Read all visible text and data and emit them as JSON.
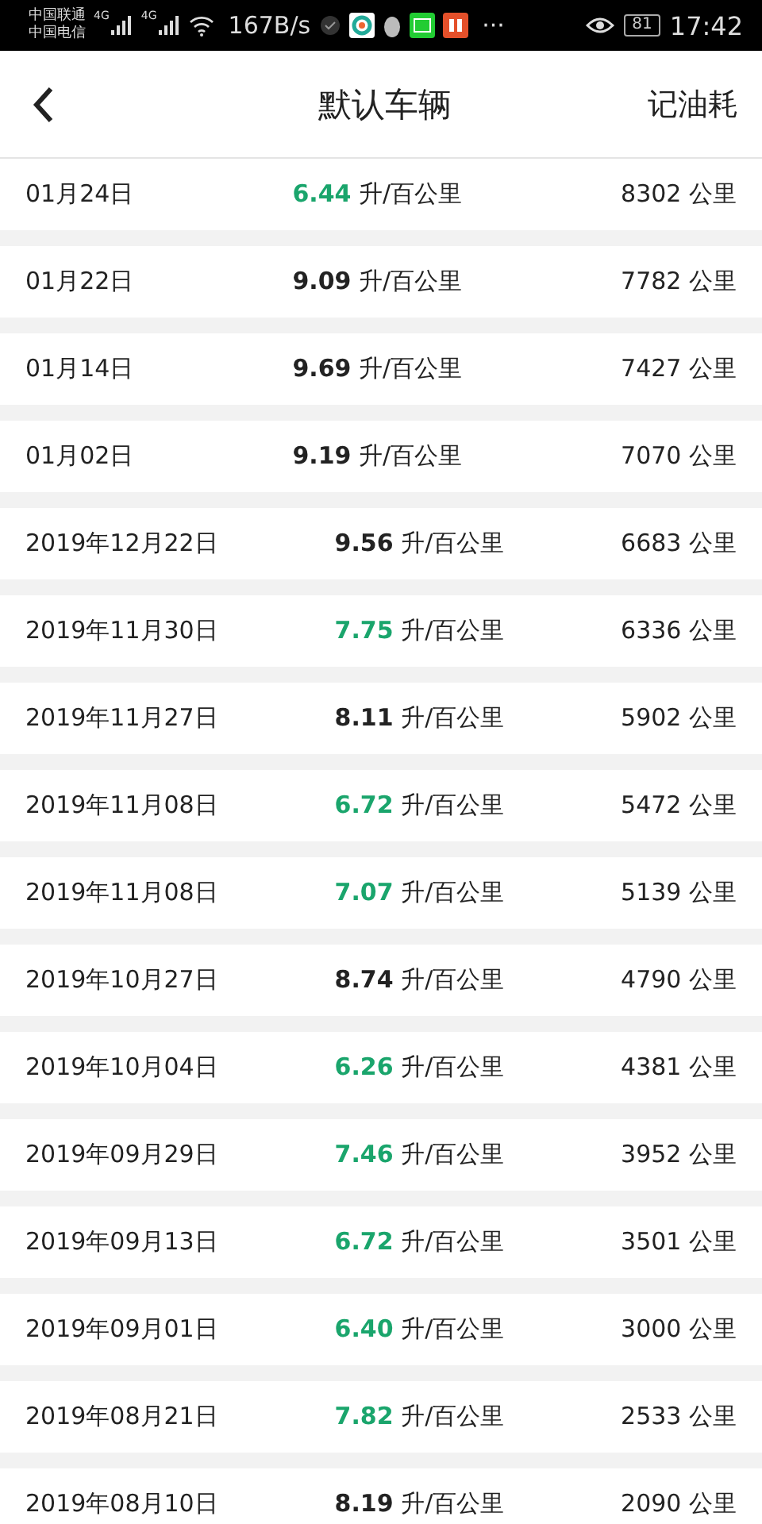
{
  "status_bar": {
    "carriers": [
      "中国联通",
      "中国电信"
    ],
    "network_labels": [
      "4G",
      "4G"
    ],
    "speed": "167B/s",
    "more": "···",
    "battery": "81",
    "time": "17:42"
  },
  "header": {
    "title": "默认车辆",
    "action": "记油耗"
  },
  "records": [
    {
      "date": "01月24日",
      "consumption": "6.44",
      "unit": "升/百公里",
      "odometer": "8302 公里",
      "highlight": true
    },
    {
      "date": "01月22日",
      "consumption": "9.09",
      "unit": "升/百公里",
      "odometer": "7782 公里",
      "highlight": false
    },
    {
      "date": "01月14日",
      "consumption": "9.69",
      "unit": "升/百公里",
      "odometer": "7427 公里",
      "highlight": false
    },
    {
      "date": "01月02日",
      "consumption": "9.19",
      "unit": "升/百公里",
      "odometer": "7070 公里",
      "highlight": false
    },
    {
      "date": "2019年12月22日",
      "consumption": "9.56",
      "unit": "升/百公里",
      "odometer": "6683 公里",
      "highlight": false
    },
    {
      "date": "2019年11月30日",
      "consumption": "7.75",
      "unit": "升/百公里",
      "odometer": "6336 公里",
      "highlight": true
    },
    {
      "date": "2019年11月27日",
      "consumption": "8.11",
      "unit": "升/百公里",
      "odometer": "5902 公里",
      "highlight": false
    },
    {
      "date": "2019年11月08日",
      "consumption": "6.72",
      "unit": "升/百公里",
      "odometer": "5472 公里",
      "highlight": true
    },
    {
      "date": "2019年11月08日",
      "consumption": "7.07",
      "unit": "升/百公里",
      "odometer": "5139 公里",
      "highlight": true
    },
    {
      "date": "2019年10月27日",
      "consumption": "8.74",
      "unit": "升/百公里",
      "odometer": "4790 公里",
      "highlight": false
    },
    {
      "date": "2019年10月04日",
      "consumption": "6.26",
      "unit": "升/百公里",
      "odometer": "4381 公里",
      "highlight": true
    },
    {
      "date": "2019年09月29日",
      "consumption": "7.46",
      "unit": "升/百公里",
      "odometer": "3952 公里",
      "highlight": true
    },
    {
      "date": "2019年09月13日",
      "consumption": "6.72",
      "unit": "升/百公里",
      "odometer": "3501 公里",
      "highlight": true
    },
    {
      "date": "2019年09月01日",
      "consumption": "6.40",
      "unit": "升/百公里",
      "odometer": "3000 公里",
      "highlight": true
    },
    {
      "date": "2019年08月21日",
      "consumption": "7.82",
      "unit": "升/百公里",
      "odometer": "2533 公里",
      "highlight": true
    },
    {
      "date": "2019年08月10日",
      "consumption": "8.19",
      "unit": "升/百公里",
      "odometer": "2090 公里",
      "highlight": false
    }
  ]
}
